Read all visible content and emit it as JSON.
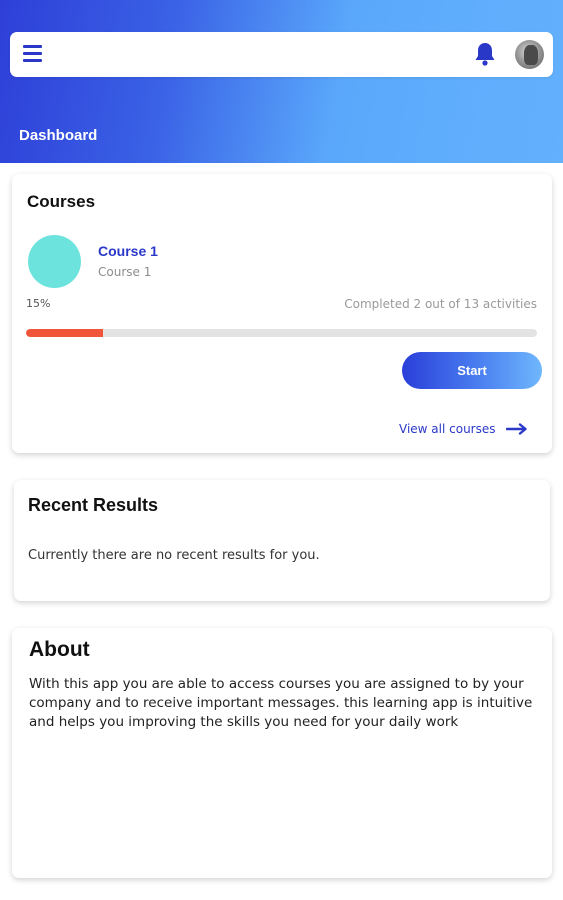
{
  "header": {
    "title": "Dashboard",
    "menu_icon": "hamburger-menu-icon",
    "notification_icon": "bell-icon",
    "avatar": "user-avatar"
  },
  "courses_card": {
    "title": "Courses",
    "course": {
      "name": "Course 1",
      "subtitle": "Course 1",
      "thumb_color": "#6de3dd"
    },
    "progress": {
      "percent_label": "15%",
      "percent_value": 15,
      "status": "Completed 2 out of 13 activities"
    },
    "start_label": "Start",
    "view_all_label": "View all courses"
  },
  "recent_results": {
    "title": "Recent Results",
    "empty_text": "Currently there are no recent results for you."
  },
  "about": {
    "title": "About",
    "body": "With this app you are able to access courses you are assigned to by your company and to receive important messages. this learning app is intuitive and helps you improving the skills you need for your daily work"
  },
  "colors": {
    "accent_blue": "#2a38c8",
    "progress_fill": "#f0553a",
    "header_gradient_start": "#2e3fd8",
    "header_gradient_end": "#63b1fd"
  }
}
